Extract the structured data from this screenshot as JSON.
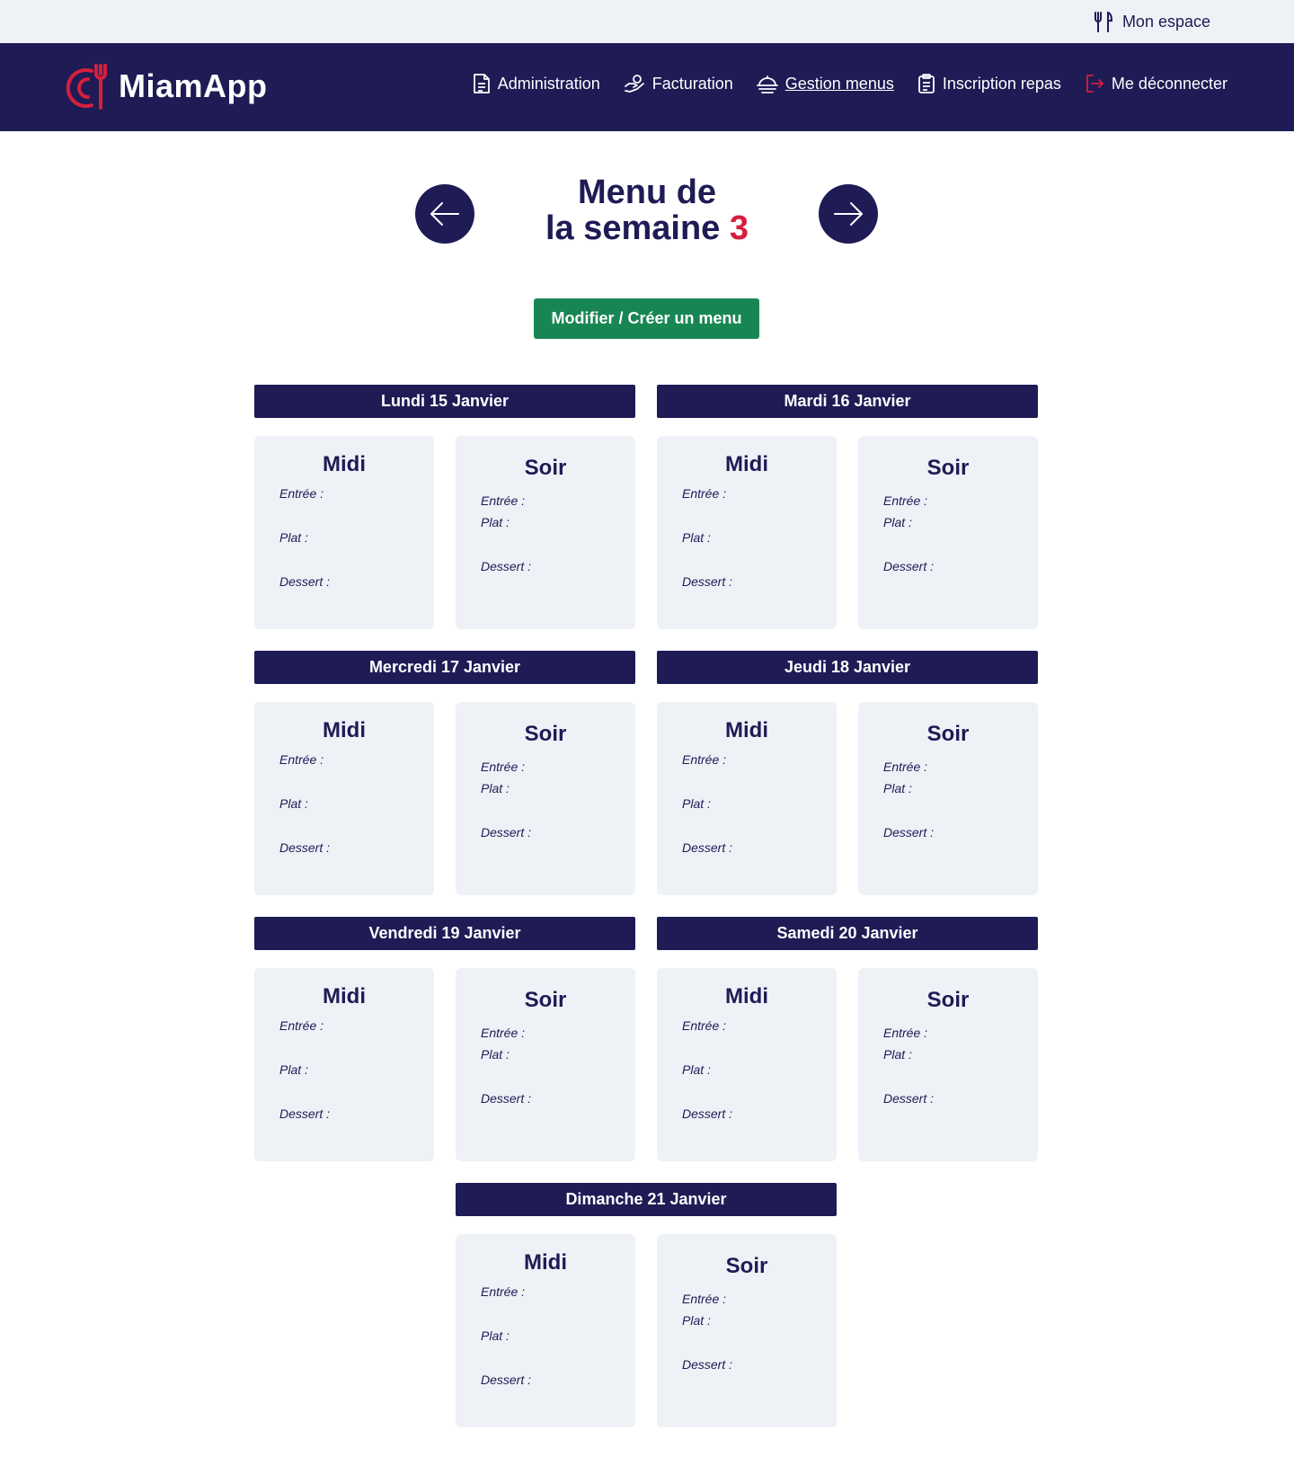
{
  "topbar": {
    "mon_espace": "Mon espace"
  },
  "brand": {
    "name": "MiamApp"
  },
  "nav": [
    {
      "label": "Administration",
      "active": false
    },
    {
      "label": "Facturation",
      "active": false
    },
    {
      "label": "Gestion menus",
      "active": true
    },
    {
      "label": "Inscription repas",
      "active": false
    },
    {
      "label": "Me déconnecter",
      "active": false
    }
  ],
  "title": {
    "line1": "Menu de",
    "line2": "la semaine",
    "week": "3"
  },
  "actions": {
    "create_menu": "Modifier / Créer un menu"
  },
  "days": [
    {
      "label": "Lundi 15 Janvier",
      "midi": {
        "title": "Midi",
        "entree": "Entrée :",
        "plat": "Plat :",
        "dessert": "Dessert :"
      },
      "soir": {
        "title": "Soir",
        "entree": "Entrée :",
        "plat": "Plat :",
        "dessert": "Dessert :"
      }
    },
    {
      "label": "Mardi 16 Janvier",
      "midi": {
        "title": "Midi",
        "entree": "Entrée :",
        "plat": "Plat :",
        "dessert": "Dessert :"
      },
      "soir": {
        "title": "Soir",
        "entree": "Entrée :",
        "plat": "Plat :",
        "dessert": "Dessert :"
      }
    },
    {
      "label": "Mercredi 17 Janvier",
      "midi": {
        "title": "Midi",
        "entree": "Entrée :",
        "plat": "Plat :",
        "dessert": "Dessert :"
      },
      "soir": {
        "title": "Soir",
        "entree": "Entrée :",
        "plat": "Plat :",
        "dessert": "Dessert :"
      }
    },
    {
      "label": "Jeudi 18 Janvier",
      "midi": {
        "title": "Midi",
        "entree": "Entrée :",
        "plat": "Plat :",
        "dessert": "Dessert :"
      },
      "soir": {
        "title": "Soir",
        "entree": "Entrée :",
        "plat": "Plat :",
        "dessert": "Dessert :"
      }
    },
    {
      "label": "Vendredi 19 Janvier",
      "midi": {
        "title": "Midi",
        "entree": "Entrée :",
        "plat": "Plat :",
        "dessert": "Dessert :"
      },
      "soir": {
        "title": "Soir",
        "entree": "Entrée :",
        "plat": "Plat :",
        "dessert": "Dessert :"
      }
    },
    {
      "label": "Samedi 20 Janvier",
      "midi": {
        "title": "Midi",
        "entree": "Entrée :",
        "plat": "Plat :",
        "dessert": "Dessert :"
      },
      "soir": {
        "title": "Soir",
        "entree": "Entrée :",
        "plat": "Plat :",
        "dessert": "Dessert :"
      }
    },
    {
      "label": "Dimanche 21 Janvier",
      "midi": {
        "title": "Midi",
        "entree": "Entrée :",
        "plat": "Plat :",
        "dessert": "Dessert :"
      },
      "soir": {
        "title": "Soir",
        "entree": "Entrée :",
        "plat": "Plat :",
        "dessert": "Dessert :"
      }
    }
  ],
  "colors": {
    "navy": "#1e1b55",
    "accent_red": "#d61f3c",
    "green": "#188653",
    "panel": "#eef1f6"
  },
  "icons": {
    "mon_espace": "fork-knife-icon",
    "logo": "miamapp-logo-icon",
    "prev": "arrow-left-icon",
    "next": "arrow-right-icon"
  }
}
